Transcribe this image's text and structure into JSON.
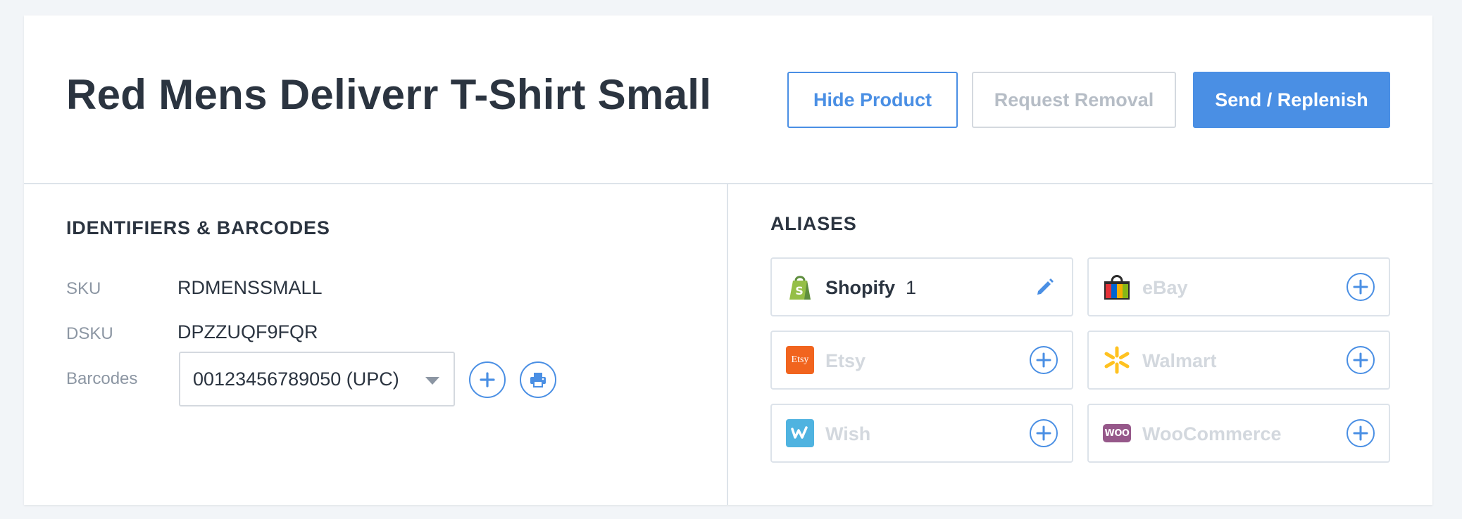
{
  "product": {
    "title": "Red Mens Deliverr T-Shirt Small"
  },
  "actions": {
    "hide_label": "Hide Product",
    "remove_label": "Request Removal",
    "send_label": "Send / Replenish"
  },
  "identifiers": {
    "section_title": "IDENTIFIERS & BARCODES",
    "sku_label": "SKU",
    "sku_value": "RDMENSSMALL",
    "dsku_label": "DSKU",
    "dsku_value": "DPZZUQF9FQR",
    "barcodes_label": "Barcodes",
    "barcode_selected": "00123456789050 (UPC)"
  },
  "aliases": {
    "section_title": "ALIASES",
    "items": [
      {
        "name": "Shopify",
        "count": "1",
        "active": true,
        "icon": "shopify-icon"
      },
      {
        "name": "eBay",
        "active": false,
        "icon": "ebay-icon"
      },
      {
        "name": "Etsy",
        "active": false,
        "icon": "etsy-icon",
        "logo_text": "Etsy"
      },
      {
        "name": "Walmart",
        "active": false,
        "icon": "walmart-icon"
      },
      {
        "name": "Wish",
        "active": false,
        "icon": "wish-icon"
      },
      {
        "name": "WooCommerce",
        "active": false,
        "icon": "woocommerce-icon",
        "logo_text": "WOO"
      }
    ]
  },
  "colors": {
    "accent": "#4a8fe4",
    "text_dark": "#2b3440",
    "text_muted": "#8c96a3",
    "disabled_text": "#d3d8de",
    "border": "#dde3ea",
    "background": "#f2f5f8"
  }
}
